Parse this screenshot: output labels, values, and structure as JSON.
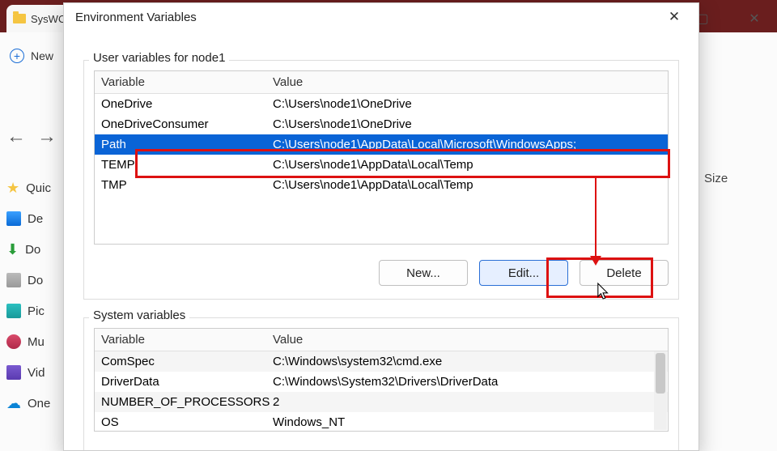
{
  "backdrop": {
    "tab_label": "SysWOW",
    "new_label": "New",
    "size_header": "Size",
    "sidebar": [
      "Quic",
      "De",
      "Do",
      "Do",
      "Pic",
      "Mu",
      "Vid",
      "One"
    ]
  },
  "dialog": {
    "title": "Environment Variables",
    "user_group_label": "User variables for node1",
    "sys_group_label": "System variables",
    "col_variable": "Variable",
    "col_value": "Value",
    "user_vars": [
      {
        "name": "OneDrive",
        "value": "C:\\Users\\node1\\OneDrive"
      },
      {
        "name": "OneDriveConsumer",
        "value": "C:\\Users\\node1\\OneDrive"
      },
      {
        "name": "Path",
        "value": "C:\\Users\\node1\\AppData\\Local\\Microsoft\\WindowsApps;"
      },
      {
        "name": "TEMP",
        "value": "C:\\Users\\node1\\AppData\\Local\\Temp"
      },
      {
        "name": "TMP",
        "value": "C:\\Users\\node1\\AppData\\Local\\Temp"
      }
    ],
    "selected_user_index": 2,
    "sys_vars": [
      {
        "name": "ComSpec",
        "value": "C:\\Windows\\system32\\cmd.exe"
      },
      {
        "name": "DriverData",
        "value": "C:\\Windows\\System32\\Drivers\\DriverData"
      },
      {
        "name": "NUMBER_OF_PROCESSORS",
        "value": "2"
      },
      {
        "name": "OS",
        "value": "Windows_NT"
      }
    ],
    "buttons": {
      "new": "New...",
      "edit": "Edit...",
      "delete": "Delete"
    }
  }
}
